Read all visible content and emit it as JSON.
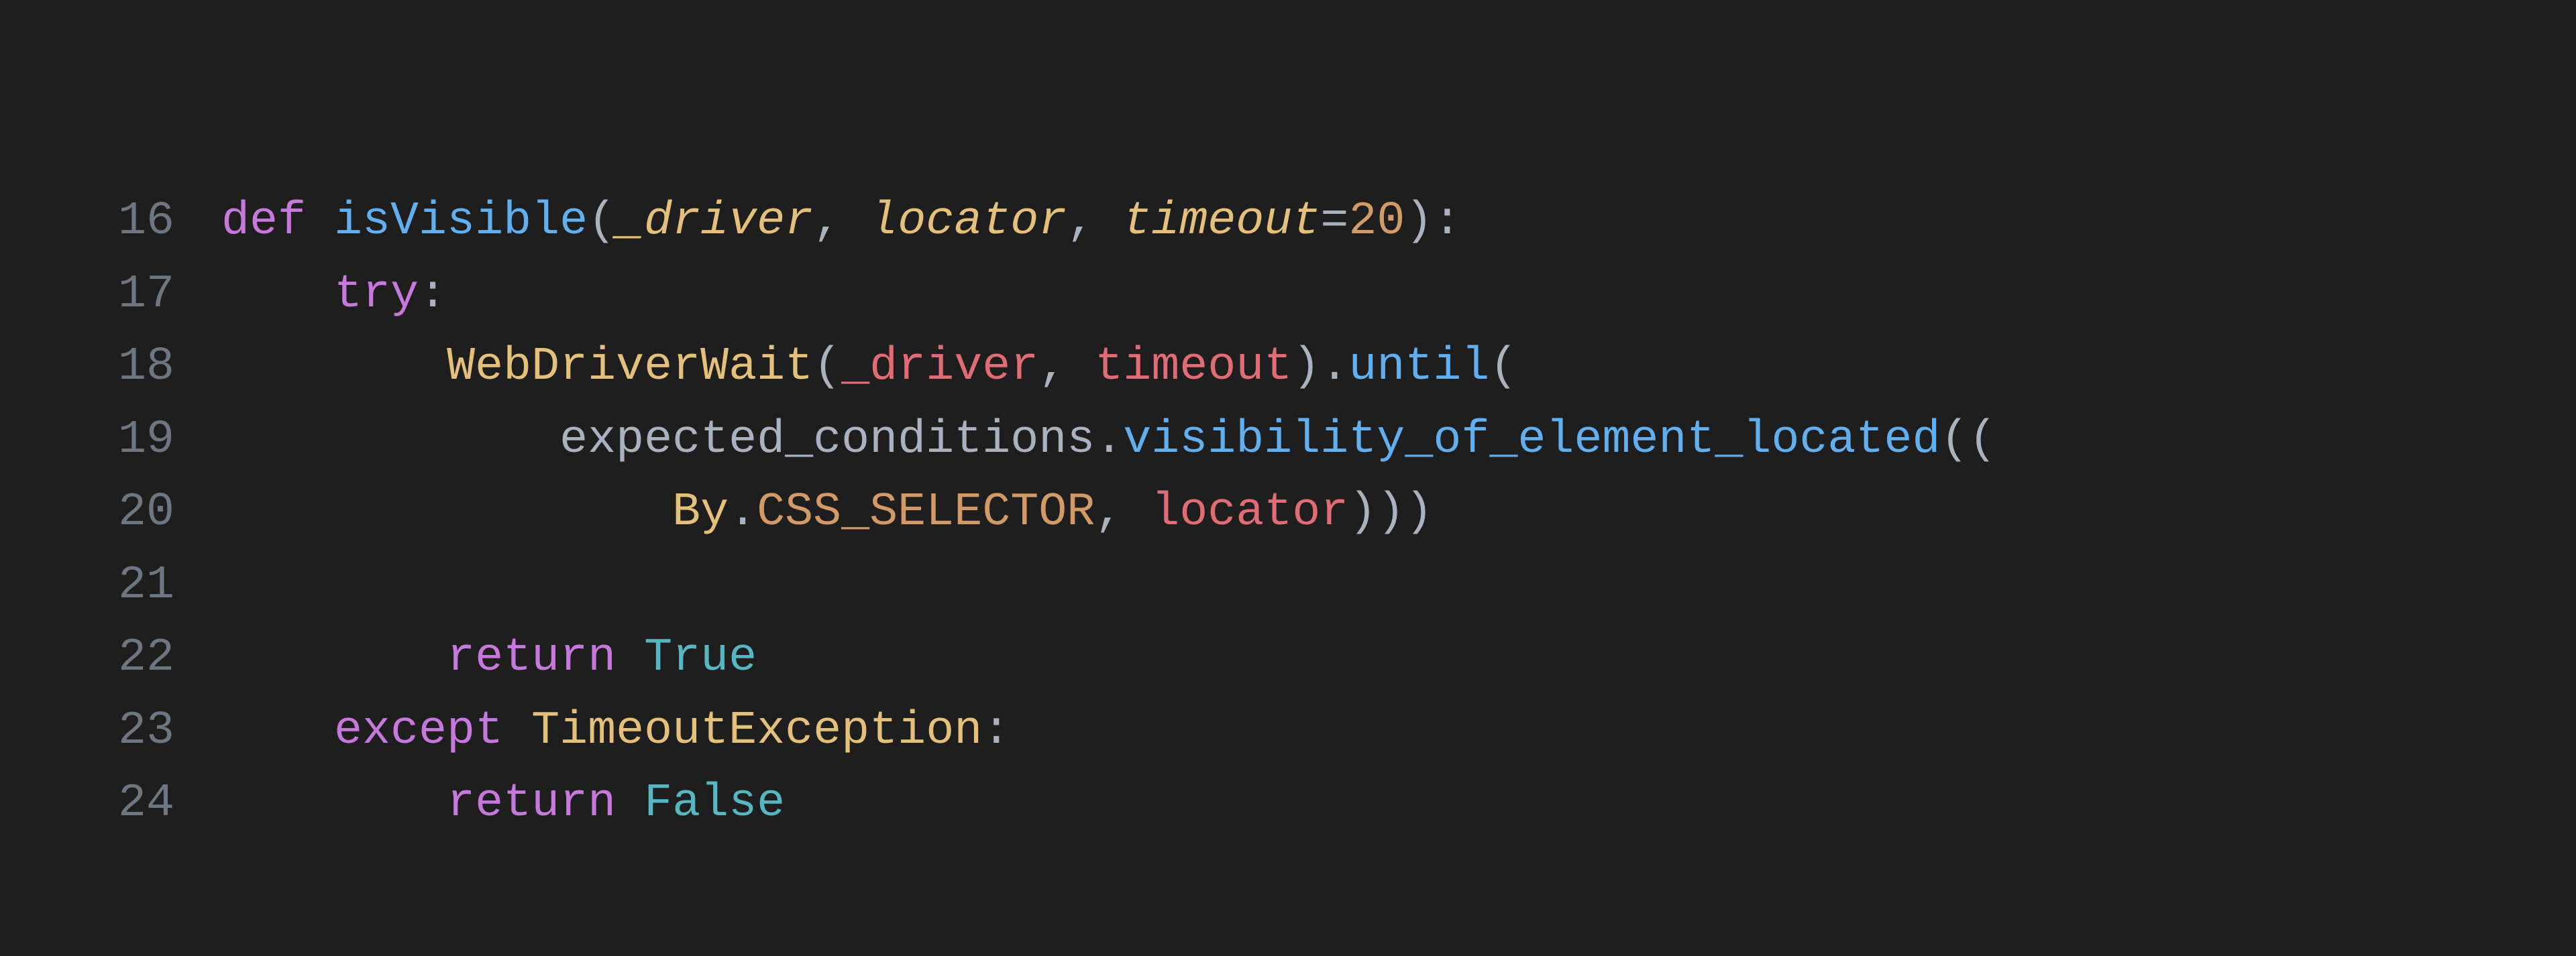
{
  "editor": {
    "language": "python",
    "lines": [
      {
        "number": "16",
        "indent": "",
        "tokens": [
          {
            "t": "def ",
            "c": "kw"
          },
          {
            "t": "isVisible",
            "c": "fn"
          },
          {
            "t": "(",
            "c": "punct"
          },
          {
            "t": "_driver",
            "c": "param"
          },
          {
            "t": ", ",
            "c": "punct"
          },
          {
            "t": "locator",
            "c": "param"
          },
          {
            "t": ", ",
            "c": "punct"
          },
          {
            "t": "timeout",
            "c": "param"
          },
          {
            "t": "=",
            "c": "op"
          },
          {
            "t": "20",
            "c": "num"
          },
          {
            "t": "):",
            "c": "punct"
          }
        ]
      },
      {
        "number": "17",
        "indent": "    ",
        "tokens": [
          {
            "t": "try",
            "c": "kw"
          },
          {
            "t": ":",
            "c": "punct"
          }
        ]
      },
      {
        "number": "18",
        "indent": "        ",
        "tokens": [
          {
            "t": "WebDriverWait",
            "c": "cls"
          },
          {
            "t": "(",
            "c": "punct"
          },
          {
            "t": "_driver",
            "c": "paramref"
          },
          {
            "t": ", ",
            "c": "punct"
          },
          {
            "t": "timeout",
            "c": "paramref"
          },
          {
            "t": ").",
            "c": "punct"
          },
          {
            "t": "until",
            "c": "fn"
          },
          {
            "t": "(",
            "c": "punct"
          }
        ]
      },
      {
        "number": "19",
        "indent": "            ",
        "tokens": [
          {
            "t": "expected_conditions",
            "c": "var"
          },
          {
            "t": ".",
            "c": "punct"
          },
          {
            "t": "visibility_of_element_located",
            "c": "fn"
          },
          {
            "t": "((",
            "c": "punct"
          }
        ]
      },
      {
        "number": "20",
        "indent": "                ",
        "tokens": [
          {
            "t": "By",
            "c": "cls"
          },
          {
            "t": ".",
            "c": "punct"
          },
          {
            "t": "CSS_SELECTOR",
            "c": "attr"
          },
          {
            "t": ", ",
            "c": "punct"
          },
          {
            "t": "locator",
            "c": "paramref"
          },
          {
            "t": ")))",
            "c": "punct"
          }
        ]
      },
      {
        "number": "21",
        "indent": "",
        "tokens": []
      },
      {
        "number": "22",
        "indent": "        ",
        "tokens": [
          {
            "t": "return ",
            "c": "kw"
          },
          {
            "t": "True",
            "c": "bool"
          }
        ]
      },
      {
        "number": "23",
        "indent": "    ",
        "tokens": [
          {
            "t": "except ",
            "c": "kw"
          },
          {
            "t": "TimeoutException",
            "c": "cls"
          },
          {
            "t": ":",
            "c": "punct"
          }
        ]
      },
      {
        "number": "24",
        "indent": "        ",
        "tokens": [
          {
            "t": "return ",
            "c": "kw"
          },
          {
            "t": "False",
            "c": "bool"
          }
        ]
      }
    ]
  }
}
